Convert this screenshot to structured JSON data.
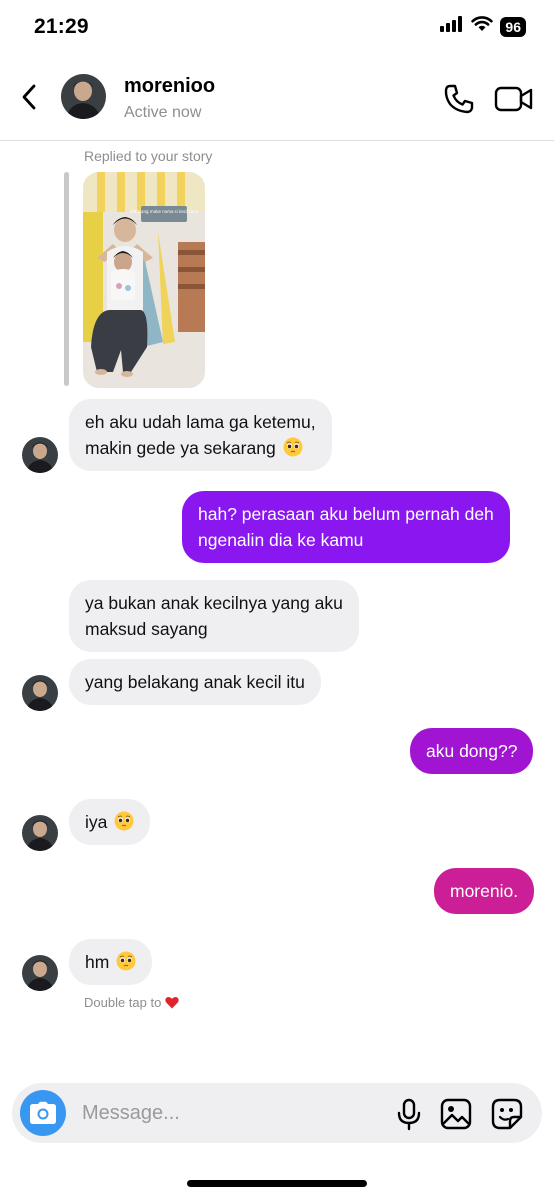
{
  "status_bar": {
    "time": "21:29",
    "battery": "96"
  },
  "header": {
    "name": "morenioo",
    "status": "Active now"
  },
  "story": {
    "replied_label": "Replied to your story",
    "caption": "sekarang make nama si kecil lucu"
  },
  "messages": [
    {
      "side": "received",
      "lines": [
        "eh aku udah lama ga ketemu,",
        "makin gede ya sekarang"
      ],
      "emoji": "pleading-face"
    },
    {
      "side": "sent",
      "lines": [
        "hah? perasaan aku belum pernah deh",
        "ngenalin dia ke kamu"
      ],
      "color": "#8a16f0"
    },
    {
      "side": "received",
      "lines": [
        "ya bukan anak kecilnya yang aku",
        "maksud sayang"
      ]
    },
    {
      "side": "received",
      "lines": [
        "yang belakang anak kecil itu"
      ]
    },
    {
      "side": "sent",
      "lines": [
        "aku dong??"
      ],
      "color": "#a114d2"
    },
    {
      "side": "received",
      "lines": [
        "iya"
      ],
      "emoji": "pleading-face"
    },
    {
      "side": "sent",
      "lines": [
        "morenio."
      ],
      "color": "#cc1e96"
    },
    {
      "side": "received",
      "lines": [
        "hm"
      ],
      "emoji": "pleading-face"
    }
  ],
  "double_tap_hint": "Double tap to",
  "composer": {
    "placeholder": "Message..."
  },
  "icons": {
    "back": "chevron-left-icon",
    "call": "phone-icon",
    "video": "video-camera-icon",
    "camera": "camera-icon",
    "mic": "microphone-icon",
    "gallery": "image-icon",
    "sticker": "sticker-icon",
    "heart": "heart-icon"
  },
  "colors": {
    "accent_blue": "#3897f0",
    "received_bubble": "#efeff1",
    "heart": "#e0242e"
  }
}
